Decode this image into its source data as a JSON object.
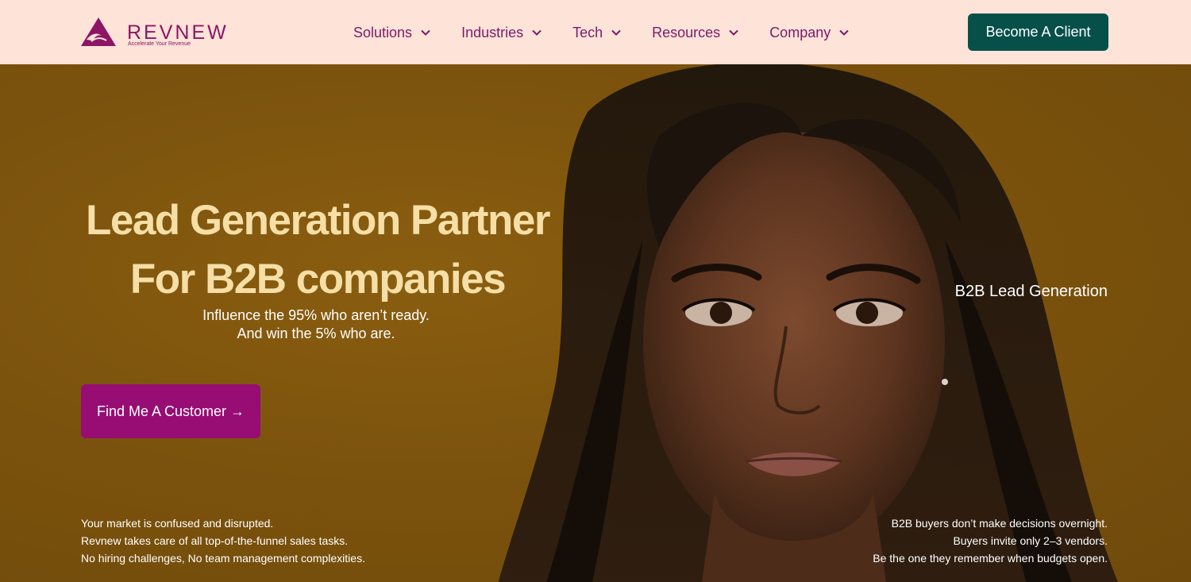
{
  "brand": {
    "name": "REVNEW",
    "tagline": "Accelerate Your Revenue",
    "color": "#8e1566"
  },
  "nav": {
    "items": [
      {
        "label": "Solutions",
        "icon": "chevron-down-icon"
      },
      {
        "label": "Industries",
        "icon": "chevron-down-icon"
      },
      {
        "label": "Tech",
        "icon": "chevron-down-icon"
      },
      {
        "label": "Resources",
        "icon": "chevron-down-icon"
      },
      {
        "label": "Company",
        "icon": "chevron-down-icon"
      }
    ],
    "cta_label": "Become A Client"
  },
  "hero": {
    "title_line1": "Lead Generation Partner",
    "title_line2": "For B2B companies",
    "sub_line1": "Influence the 95% who aren’t ready.",
    "sub_line2": "And win the 5% who are.",
    "cta_label": "Find Me A Customer →",
    "side_tag": "B2B Lead Generation",
    "note_left": [
      "Your market is confused and disrupted.",
      "Revnew takes care of all top-of-the-funnel sales tasks.",
      "No hiring challenges, No team management complexities."
    ],
    "note_right": [
      "B2B buyers don’t make decisions overnight.",
      "Buyers invite only 2–3 vendors.",
      "Be the one they remember when budgets open."
    ]
  },
  "colors": {
    "header_bg": "#fde3d8",
    "nav_text": "#7b1a6a",
    "client_button": "#07504a",
    "find_button": "#970d73",
    "hero_bg": "#7c530d",
    "title": "#f6dfa6"
  }
}
